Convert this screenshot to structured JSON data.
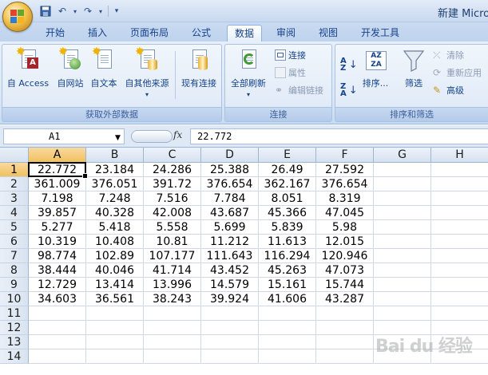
{
  "title_bar": {
    "title": "新建 Micro"
  },
  "tabs": [
    "开始",
    "插入",
    "页面布局",
    "公式",
    "数据",
    "审阅",
    "视图",
    "开发工具"
  ],
  "active_tab": "数据",
  "ribbon": {
    "get_external": {
      "label": "获取外部数据",
      "buttons": [
        "自 Access",
        "自网站",
        "自文本",
        "自其他来源",
        "现有连接"
      ]
    },
    "connections": {
      "label": "连接",
      "refresh_all": "全部刷新",
      "connect": "连接",
      "properties": "属性",
      "edit_links": "编辑链接"
    },
    "sort_filter": {
      "label": "排序和筛选",
      "sort": "排序...",
      "filter": "筛选",
      "clear": "清除",
      "reapply": "重新应用",
      "advanced": "高级"
    }
  },
  "formula_bar": {
    "name_box": "A1",
    "fx": "fx",
    "formula": "22.772"
  },
  "columns": [
    "A",
    "B",
    "C",
    "D",
    "E",
    "F",
    "G",
    "H"
  ],
  "selected_column": "A",
  "selected_row": 1,
  "rows": [
    [
      "22.772",
      "23.184",
      "24.286",
      "25.388",
      "26.49",
      "27.592"
    ],
    [
      "361.009",
      "376.051",
      "391.72",
      "376.654",
      "362.167",
      "376.654"
    ],
    [
      "7.198",
      "7.248",
      "7.516",
      "7.784",
      "8.051",
      "8.319"
    ],
    [
      "39.857",
      "40.328",
      "42.008",
      "43.687",
      "45.366",
      "47.045"
    ],
    [
      "5.277",
      "5.418",
      "5.558",
      "5.699",
      "5.839",
      "5.98"
    ],
    [
      "10.319",
      "10.408",
      "10.81",
      "11.212",
      "11.613",
      "12.015"
    ],
    [
      "98.774",
      "102.89",
      "107.177",
      "111.643",
      "116.294",
      "120.946"
    ],
    [
      "38.444",
      "40.046",
      "41.714",
      "43.452",
      "45.263",
      "47.073"
    ],
    [
      "12.729",
      "13.414",
      "13.996",
      "14.579",
      "15.161",
      "15.744"
    ],
    [
      "34.603",
      "36.561",
      "38.243",
      "39.924",
      "41.606",
      "43.287"
    ]
  ],
  "row_numbers": [
    "1",
    "2",
    "3",
    "4",
    "5",
    "6",
    "7",
    "8",
    "9",
    "10",
    "11",
    "12",
    "13",
    "14"
  ],
  "watermark": "Bai du 经验",
  "colors": {
    "selection": "#f1c15f",
    "ribbon": "#dbe7f6",
    "header": "#d6e1ef"
  }
}
